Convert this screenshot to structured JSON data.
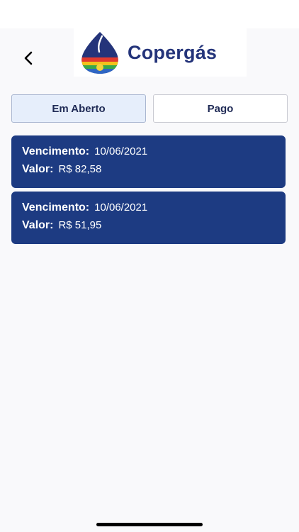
{
  "header": {
    "brand_name": "Copergás"
  },
  "tabs": [
    {
      "label": "Em Aberto",
      "active": true
    },
    {
      "label": "Pago",
      "active": false
    }
  ],
  "bills": [
    {
      "due_label": "Vencimento:",
      "due_date": "10/06/2021",
      "amount_label": "Valor:",
      "amount": "R$ 82,58"
    },
    {
      "due_label": "Vencimento:",
      "due_date": "10/06/2021",
      "amount_label": "Valor:",
      "amount": "R$ 51,95"
    }
  ],
  "colors": {
    "card_bg": "#1d3b82",
    "brand_blue": "#24347a",
    "active_tab_bg": "#e6eefb"
  }
}
